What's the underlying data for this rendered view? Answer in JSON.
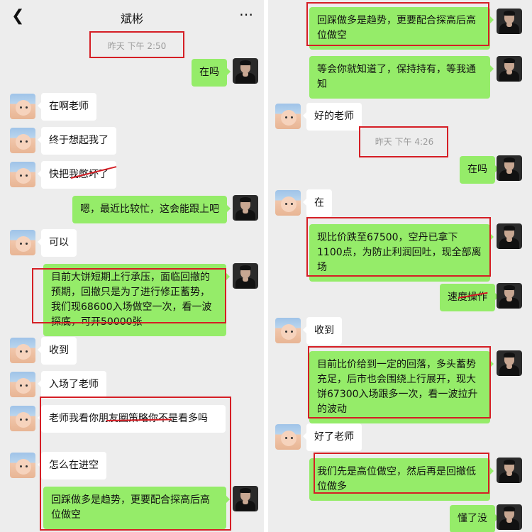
{
  "header": {
    "back_icon": "chevron-left-icon",
    "title": "斌彬",
    "more_icon": "ellipsis-icon"
  },
  "left": {
    "timestamp": "昨天 下午 2:50",
    "messages": [
      {
        "from": "me",
        "text": "在吗"
      },
      {
        "from": "contact",
        "text": "在啊老师"
      },
      {
        "from": "contact",
        "text": "终于想起我了"
      },
      {
        "from": "contact",
        "text": "快把我憋坏了"
      },
      {
        "from": "me",
        "text": "嗯，最近比较忙，这会能跟上吧"
      },
      {
        "from": "contact",
        "text": "可以"
      },
      {
        "from": "me",
        "text": "目前大饼短期上行承压，面临回撤的预期，回撤只是为了进行修正蓄势，我们现68600入场做空一次，看一波探底，可开50000张"
      },
      {
        "from": "contact",
        "text": "收到"
      },
      {
        "from": "contact",
        "text": "入场了老师"
      },
      {
        "from": "contact",
        "text": "老师我看你朋友圈策略你不是看多吗"
      },
      {
        "from": "contact",
        "text": "怎么在进空"
      },
      {
        "from": "me",
        "text": "回踩做多是趋势，更要配合探高后高位做空"
      }
    ]
  },
  "right": {
    "timestamp": "昨天 下午 4:26",
    "messages": [
      {
        "from": "me",
        "text": "回踩做多是趋势，更要配合探高后高位做空"
      },
      {
        "from": "me",
        "text": "等会你就知道了，保持持有，等我通知"
      },
      {
        "from": "contact",
        "text": "好的老师"
      },
      {
        "from": "me",
        "text": "在吗"
      },
      {
        "from": "contact",
        "text": "在"
      },
      {
        "from": "me",
        "text": "现比价跌至67500，空丹已拿下1100点，为防止利润回吐，现全部离场"
      },
      {
        "from": "me",
        "text": "速度操作"
      },
      {
        "from": "contact",
        "text": "收到"
      },
      {
        "from": "me",
        "text": "目前比价给到一定的回落，多头蓄势充足，后市也会围绕上行展开，现大饼67300入场跟多一次，看一波拉升的波动"
      },
      {
        "from": "contact",
        "text": "好了老师"
      },
      {
        "from": "me",
        "text": "我们先是高位做空，然后再是回撤低位做多"
      },
      {
        "from": "me",
        "text": "懂了没"
      }
    ]
  },
  "colors": {
    "chat_bg": "#ededed",
    "incoming_bubble": "#ffffff",
    "outgoing_bubble": "#95ec69",
    "annotation_red": "#d51e25",
    "timestamp_text": "#9b9b9b"
  }
}
